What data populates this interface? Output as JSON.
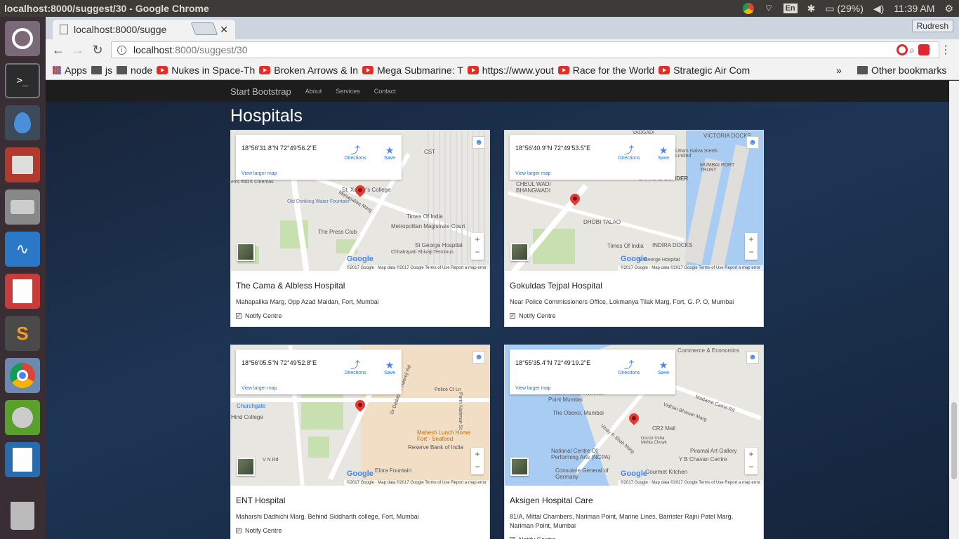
{
  "system": {
    "window_title": "localhost:8000/suggest/30 - Google Chrome",
    "keyboard": "En",
    "battery": "(29%)",
    "clock": "11:39 AM"
  },
  "browser": {
    "tab_title": "localhost:8000/sugge",
    "user": "Rudresh",
    "url_host": "localhost",
    "url_path": ":8000/suggest/30",
    "bookmarks": [
      "Apps",
      "js",
      "node",
      "Nukes in Space-Th",
      "Broken Arrows & In",
      "Mega Submarine: T",
      "https://www.yout",
      "Race for the World",
      "Strategic Air Com"
    ],
    "more": "»",
    "other_bookmarks": "Other bookmarks"
  },
  "site": {
    "brand": "Start Bootstrap",
    "nav": [
      "About",
      "Services",
      "Contact"
    ],
    "heading": "Hospitals",
    "map_ui": {
      "view_larger": "View larger map",
      "directions": "Directions",
      "save": "Save",
      "attribution": "©2017 Google · Map data ©2017 Google   Terms of Use   Report a map error",
      "google": "Google"
    },
    "notify_label": "Notify Centre",
    "hospitals": [
      {
        "coords": "18°56'31.8\"N 72°49'56.2\"E",
        "name": "The Cama & Albless Hospital",
        "address": "Mahapalika Marg, Opp Azad Maidan, Fort, Mumbai",
        "labels": [
          "CST",
          "St. Xavier's College",
          "Times Of India",
          "Metropolitan Magistrate Court",
          "The Press Club",
          "St George Hospital",
          "Chhatrapati Shivaji Terminus",
          "Mahapalika Marg",
          "Old Drinking Water Fountain",
          "etro INOX Cinemas"
        ]
      },
      {
        "coords": "18°56'40.9\"N 72°49'53.5\"E",
        "name": "Gokuldas Tejpal Hospital",
        "address": "Near Police Commissioners Office, Lokmanya Tilak Marg, Fort, G. P. O, Mumbai",
        "labels": [
          "VICTORIA DOCKS",
          "Uttam Galva Steels Limited",
          "MUMBAI PORT TRUST",
          "CARNAC BUNDER",
          "CHEUL WADI BHANGWADI",
          "DHOBI TALAO",
          "Times Of India",
          "INDIRA DOCKS",
          "St George Hospital",
          "VADGADI"
        ]
      },
      {
        "coords": "18°56'05.5\"N 72°49'52.8\"E",
        "name": "ENT Hospital",
        "address": "Maharshi Dadhichi Marg, Behind Siddharth college, Fort, Mumbai",
        "labels": [
          "Churchgate",
          "Hind College",
          "Mahesh Lunch Home Fort - Seafood",
          "Reserve Bank of India",
          "Elora Fountain",
          "Dr Dadabhai Naoroji Rd",
          "Police Ct Ln",
          "V N Rd",
          "Perin Nariman St"
        ]
      },
      {
        "coords": "18°55'35.4\"N 72°49'19.2\"E",
        "name": "Aksigen Hospital Care",
        "address": "81/A, Mittal Chambers, Nariman Point, Marine Lines, Barrister Rajni Patel Marg, Nariman Point, Mumbai",
        "labels": [
          "Commerce & Economics",
          "Trident Hotel, Nariman Point Mumbai",
          "The Oberoi, Mumbai",
          "CR2 Mall",
          "Doctor Usha Mehta Chowk",
          "Piramal Art Gallery",
          "Y B Chavan Centre",
          "National Centre Of Performing Arts (NCPA)",
          "Consulate General of Germany",
          "Gourmet Kitchen",
          "Madame Cama Rd",
          "Vidhan Bhavan Marg",
          "Vinay K Shah Marg"
        ]
      }
    ]
  }
}
